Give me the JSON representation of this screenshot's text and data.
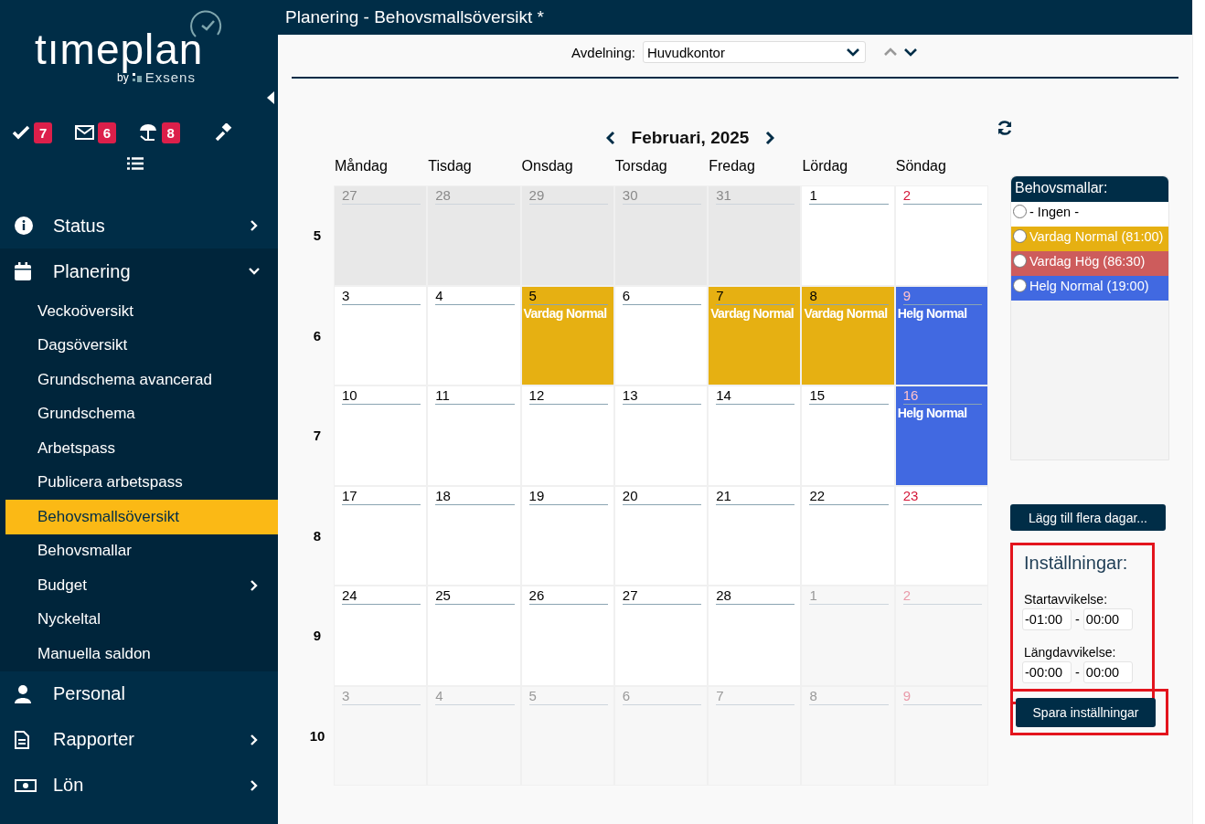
{
  "brand": {
    "name": "tımeplan",
    "by": "by",
    "company": "Exsens"
  },
  "quick_icons": [
    {
      "kind": "check",
      "badge": "7"
    },
    {
      "kind": "mail",
      "badge": "6"
    },
    {
      "kind": "beach",
      "badge": "8"
    },
    {
      "kind": "gavel"
    }
  ],
  "nav": [
    {
      "label": "Status",
      "kind": "info",
      "expanded": false,
      "has_children": true
    },
    {
      "label": "Planering",
      "kind": "calendar",
      "expanded": true,
      "has_children": true,
      "children": [
        {
          "label": "Veckoöversikt",
          "selected": false
        },
        {
          "label": "Dagsöversikt",
          "selected": false
        },
        {
          "label": "Grundschema avancerad",
          "selected": false
        },
        {
          "label": "Grundschema",
          "selected": false
        },
        {
          "label": "Arbetspass",
          "selected": false
        },
        {
          "label": "Publicera arbetspass",
          "selected": false
        },
        {
          "label": "Behovsmallsöversikt",
          "selected": true
        },
        {
          "label": "Behovsmallar",
          "selected": false
        },
        {
          "label": "Budget",
          "selected": false,
          "has_children": true
        },
        {
          "label": "Nyckeltal",
          "selected": false
        },
        {
          "label": "Manuella saldon",
          "selected": false
        }
      ]
    },
    {
      "label": "Personal",
      "kind": "person",
      "expanded": false,
      "has_children": false
    },
    {
      "label": "Rapporter",
      "kind": "document",
      "expanded": false,
      "has_children": true
    },
    {
      "label": "Lön",
      "kind": "money",
      "expanded": false,
      "has_children": true
    }
  ],
  "window": {
    "title": "Planering - Behovsmallsöversikt *"
  },
  "department": {
    "label": "Avdelning:",
    "value": "Huvudkontor"
  },
  "calendar": {
    "month": "Februari, 2025",
    "weekdays": [
      "Måndag",
      "Tisdag",
      "Onsdag",
      "Torsdag",
      "Fredag",
      "Lördag",
      "Söndag"
    ],
    "weeks": [
      {
        "week": "5",
        "days": [
          {
            "day": "27",
            "kind": "prev"
          },
          {
            "day": "28",
            "kind": "prev"
          },
          {
            "day": "29",
            "kind": "prev"
          },
          {
            "day": "30",
            "kind": "prev"
          },
          {
            "day": "31",
            "kind": "prev"
          },
          {
            "day": "1",
            "kind": "current"
          },
          {
            "day": "2",
            "kind": "current"
          }
        ]
      },
      {
        "week": "6",
        "days": [
          {
            "day": "3",
            "kind": "current"
          },
          {
            "day": "4",
            "kind": "current"
          },
          {
            "day": "5",
            "kind": "current",
            "event": "Vardag Normal",
            "color": "#e6b012"
          },
          {
            "day": "6",
            "kind": "current"
          },
          {
            "day": "7",
            "kind": "current",
            "event": "Vardag Normal",
            "color": "#e6b012"
          },
          {
            "day": "8",
            "kind": "current",
            "event": "Vardag Normal",
            "color": "#e6b012"
          },
          {
            "day": "9",
            "kind": "current",
            "event": "Helg Normal",
            "color": "#4169e1"
          }
        ]
      },
      {
        "week": "7",
        "days": [
          {
            "day": "10",
            "kind": "current"
          },
          {
            "day": "11",
            "kind": "current"
          },
          {
            "day": "12",
            "kind": "current"
          },
          {
            "day": "13",
            "kind": "current"
          },
          {
            "day": "14",
            "kind": "current"
          },
          {
            "day": "15",
            "kind": "current"
          },
          {
            "day": "16",
            "kind": "current",
            "event": "Helg Normal",
            "color": "#4169e1"
          }
        ]
      },
      {
        "week": "8",
        "days": [
          {
            "day": "17",
            "kind": "current"
          },
          {
            "day": "18",
            "kind": "current"
          },
          {
            "day": "19",
            "kind": "current"
          },
          {
            "day": "20",
            "kind": "current"
          },
          {
            "day": "21",
            "kind": "current"
          },
          {
            "day": "22",
            "kind": "current"
          },
          {
            "day": "23",
            "kind": "current"
          }
        ]
      },
      {
        "week": "9",
        "days": [
          {
            "day": "24",
            "kind": "current"
          },
          {
            "day": "25",
            "kind": "current"
          },
          {
            "day": "26",
            "kind": "current"
          },
          {
            "day": "27",
            "kind": "current"
          },
          {
            "day": "28",
            "kind": "current"
          },
          {
            "day": "1",
            "kind": "next"
          },
          {
            "day": "2",
            "kind": "next"
          }
        ]
      },
      {
        "week": "10",
        "days": [
          {
            "day": "3",
            "kind": "next"
          },
          {
            "day": "4",
            "kind": "next"
          },
          {
            "day": "5",
            "kind": "next"
          },
          {
            "day": "6",
            "kind": "next"
          },
          {
            "day": "7",
            "kind": "next"
          },
          {
            "day": "8",
            "kind": "next"
          },
          {
            "day": "9",
            "kind": "next"
          }
        ]
      }
    ]
  },
  "templates": {
    "title": "Behovsmallar:",
    "items": [
      {
        "label": "- Ingen -",
        "selected": false
      },
      {
        "label": "Vardag Normal (81:00)",
        "selected": false,
        "color": "#e6b012"
      },
      {
        "label": "Vardag Hög (86:30)",
        "selected": false,
        "color": "#cd5c5c"
      },
      {
        "label": "Helg Normal (19:00)",
        "selected": false,
        "color": "#4169e1"
      }
    ]
  },
  "add_days_button": "Lägg till flera dagar...",
  "settings": {
    "title": "Inställningar:",
    "highlighted": true,
    "fields": [
      {
        "label": "Startavvikelse:",
        "from": "-01:00",
        "separator": "-",
        "to": "00:00"
      },
      {
        "label": "Längdavvikelse:",
        "from": "-00:00",
        "separator": "-",
        "to": "00:00"
      }
    ]
  },
  "save_button": {
    "label": "Spara inställningar",
    "highlighted": true
  }
}
